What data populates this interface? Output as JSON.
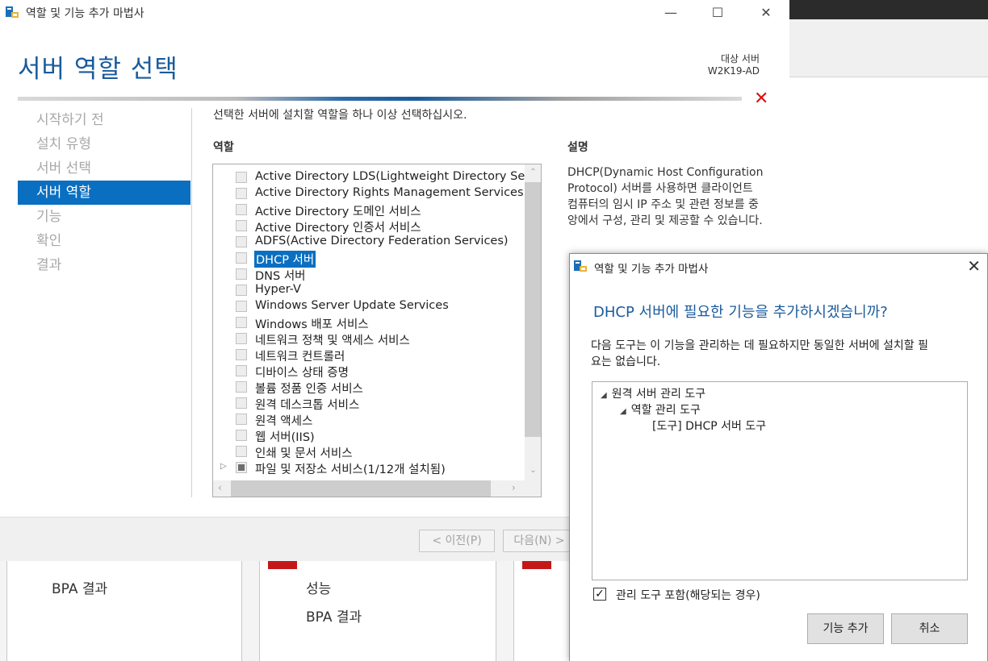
{
  "wizard": {
    "window_title": "역할 및 기능 추가 마법사",
    "page_title": "서버 역할 선택",
    "target_label": "대상 서버",
    "target_value": "W2K19-AD",
    "nav": [
      {
        "label": "시작하기 전",
        "active": false
      },
      {
        "label": "설치 유형",
        "active": false
      },
      {
        "label": "서버 선택",
        "active": false
      },
      {
        "label": "서버 역할",
        "active": true
      },
      {
        "label": "기능",
        "active": false
      },
      {
        "label": "확인",
        "active": false
      },
      {
        "label": "결과",
        "active": false
      }
    ],
    "instruction": "선택한 서버에 설치할 역할을 하나 이상 선택하십시오.",
    "roles_label": "역할",
    "roles": [
      {
        "label": "Active Directory LDS(Lightweight Directory Servic",
        "state": "unchecked"
      },
      {
        "label": "Active Directory Rights Management Services",
        "state": "unchecked"
      },
      {
        "label": "Active Directory 도메인 서비스",
        "state": "unchecked"
      },
      {
        "label": "Active Directory 인증서 서비스",
        "state": "unchecked"
      },
      {
        "label": "ADFS(Active Directory Federation Services)",
        "state": "unchecked"
      },
      {
        "label": "DHCP 서버",
        "state": "unchecked",
        "selected": true
      },
      {
        "label": "DNS 서버",
        "state": "unchecked"
      },
      {
        "label": "Hyper-V",
        "state": "unchecked"
      },
      {
        "label": "Windows Server Update Services",
        "state": "unchecked"
      },
      {
        "label": "Windows 배포 서비스",
        "state": "unchecked"
      },
      {
        "label": "네트워크 정책 및 액세스 서비스",
        "state": "unchecked"
      },
      {
        "label": "네트워크 컨트롤러",
        "state": "unchecked"
      },
      {
        "label": "디바이스 상태 증명",
        "state": "unchecked"
      },
      {
        "label": "볼륨 정품 인증 서비스",
        "state": "unchecked"
      },
      {
        "label": "원격 데스크톱 서비스",
        "state": "unchecked"
      },
      {
        "label": "원격 액세스",
        "state": "unchecked"
      },
      {
        "label": "웹 서버(IIS)",
        "state": "unchecked"
      },
      {
        "label": "인쇄 및 문서 서비스",
        "state": "unchecked"
      },
      {
        "label": "파일 및 저장소 서비스(1/12개 설치됨)",
        "state": "partial",
        "expandable": true
      }
    ],
    "description_label": "설명",
    "description": "DHCP(Dynamic Host Configuration Protocol) 서버를 사용하면 클라이언트 컴퓨터의 임시 IP 주소 및 관련 정보를 중앙에서 구성, 관리 및 제공할 수 있습니다.",
    "buttons": {
      "prev": "< 이전(P)",
      "next": "다음(N) >"
    }
  },
  "background": {
    "tile1_text": "BPA 결과",
    "tile2_text1": "성능",
    "tile2_text2": "BPA 결과"
  },
  "dialog": {
    "title": "역할 및 기능 추가 마법사",
    "heading": "DHCP 서버에 필요한 기능을 추가하시겠습니까?",
    "body": "다음 도구는 이 기능을 관리하는 데 필요하지만 동일한 서버에 설치할 필요는 없습니다.",
    "tree": [
      {
        "label": "원격 서버 관리 도구",
        "level": 0,
        "expanded": true
      },
      {
        "label": "역할 관리 도구",
        "level": 1,
        "expanded": true
      },
      {
        "label": "[도구] DHCP 서버 도구",
        "level": 2
      }
    ],
    "include_tools_label": "관리 도구 포함(해당되는 경우)",
    "include_tools_checked": true,
    "add_button": "기능 추가",
    "cancel_button": "취소"
  },
  "colors": {
    "accent": "#0a6fc1",
    "title_blue": "#1a5b9c",
    "error_red": "#e01010"
  }
}
